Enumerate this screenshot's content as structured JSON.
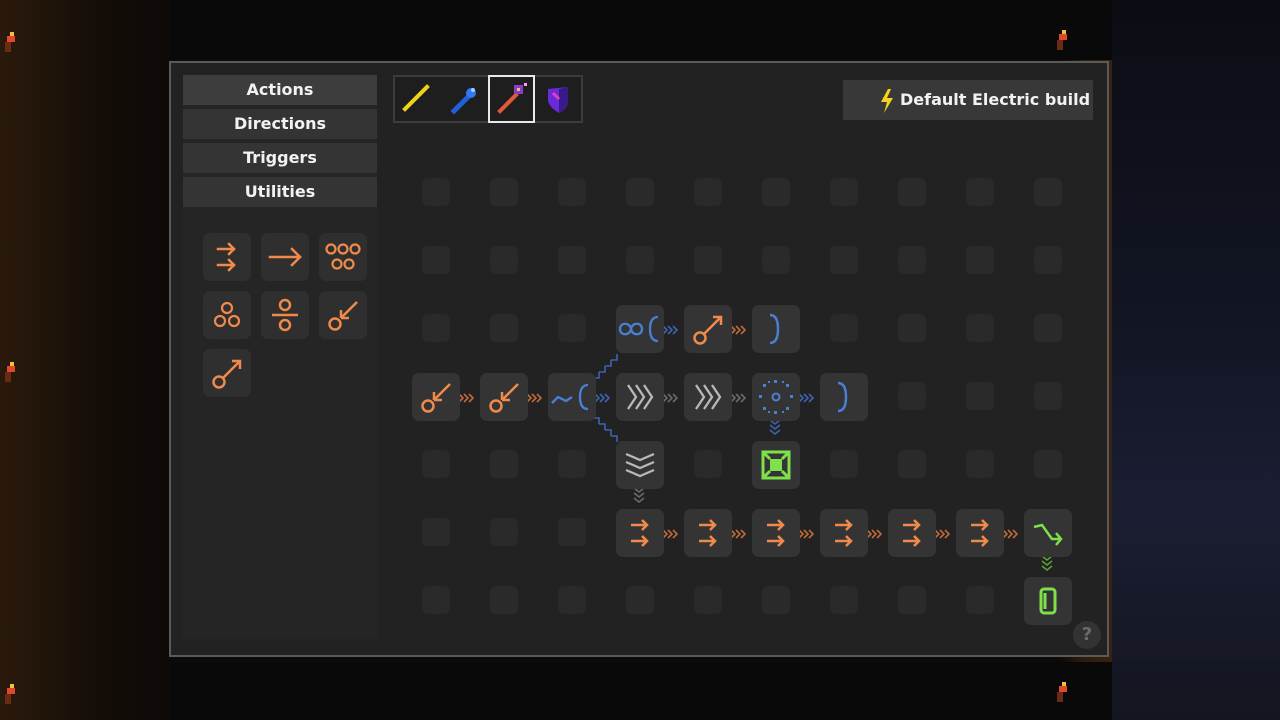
{
  "sidebar": {
    "categories": [
      "Actions",
      "Directions",
      "Triggers",
      "Utilities"
    ]
  },
  "palette": {
    "items": [
      "double-arrow-icon",
      "arrow-right-icon",
      "five-circles-icon",
      "three-circles-icon",
      "divide-icon",
      "key-down-left-icon",
      "key-up-right-icon"
    ]
  },
  "tabs": {
    "items": [
      "yellow-beam-wand-icon",
      "blue-wrench-icon",
      "magic-wand-icon",
      "purple-shield-icon"
    ],
    "selected_index": 2
  },
  "build": {
    "label": "Default Electric build",
    "icon": "lightning-bolt-icon"
  },
  "help": {
    "label": "?"
  },
  "colors": {
    "action": "#f08a4b",
    "direction": "#4b7fd6",
    "trigger": "#7ee04a",
    "utility": "#b8b8b8",
    "panel": "#222222",
    "button": "#383838"
  },
  "graph": {
    "nodes": [
      "infinity-branch-icon",
      "key-up-right-icon",
      "close-brace-icon",
      "key-down-left-icon",
      "key-down-left-icon",
      "branch-icon",
      "triple-chevron-icon",
      "triple-chevron-icon",
      "dotted-ring-icon",
      "close-brace-icon",
      "chevron-down-icon",
      "green-target-icon",
      "double-arrow-icon",
      "double-arrow-icon",
      "double-arrow-icon",
      "double-arrow-icon",
      "double-arrow-icon",
      "double-arrow-icon",
      "green-curve-arrow-icon",
      "green-zero-icon"
    ]
  }
}
